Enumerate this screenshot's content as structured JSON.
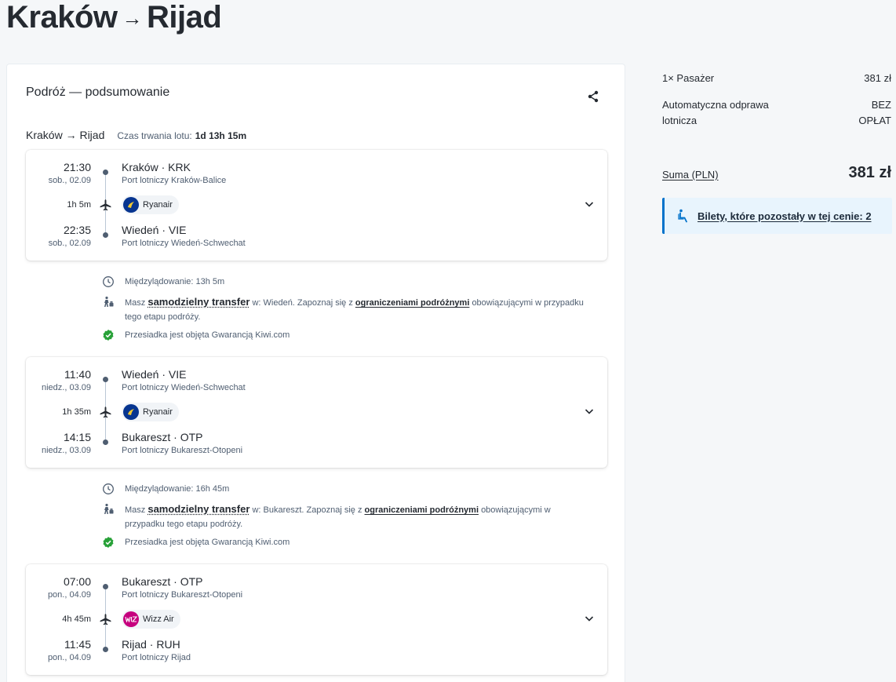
{
  "header": {
    "origin": "Kraków",
    "arrow": "→",
    "destination": "Rijad"
  },
  "summary": {
    "title": "Podróż — podsumowanie",
    "route_label": "Kraków → Rijad",
    "duration_label": "Czas trwania lotu:",
    "duration_value": "1d 13h 15m"
  },
  "segments": [
    {
      "dep_time": "21:30",
      "dep_date": "sob., 02.09",
      "dep_place": "Kraków · KRK",
      "dep_airport": "Port lotniczy Kraków-Balice",
      "duration": "1h 5m",
      "airline": "Ryanair",
      "arr_time": "22:35",
      "arr_date": "sob., 02.09",
      "arr_place": "Wiedeń · VIE",
      "arr_airport": "Port lotniczy Wiedeń-Schwechat"
    },
    {
      "dep_time": "11:40",
      "dep_date": "niedz., 03.09",
      "dep_place": "Wiedeń · VIE",
      "dep_airport": "Port lotniczy Wiedeń-Schwechat",
      "duration": "1h 35m",
      "airline": "Ryanair",
      "arr_time": "14:15",
      "arr_date": "niedz., 03.09",
      "arr_place": "Bukareszt · OTP",
      "arr_airport": "Port lotniczy Bukareszt-Otopeni"
    },
    {
      "dep_time": "07:00",
      "dep_date": "pon., 04.09",
      "dep_place": "Bukareszt · OTP",
      "dep_airport": "Port lotniczy Bukareszt-Otopeni",
      "duration": "4h 45m",
      "airline": "Wizz Air",
      "arr_time": "11:45",
      "arr_date": "pon., 04.09",
      "arr_place": "Rijad · RUH",
      "arr_airport": "Port lotniczy Rijad"
    }
  ],
  "layovers": [
    {
      "stopover": "Międzylądowanie: 13h 5m",
      "transfer_pre": "Masz",
      "transfer_link": "samodzielny transfer",
      "transfer_mid": "w: Wiedeń. Zapoznaj się z",
      "restrictions_link": "ograniczeniami podróżnymi",
      "transfer_post": "obowiązującymi w przypadku tego etapu podróży.",
      "guarantee": "Przesiadka jest objęta Gwarancją Kiwi.com"
    },
    {
      "stopover": "Międzylądowanie: 16h 45m",
      "transfer_pre": "Masz",
      "transfer_link": "samodzielny transfer",
      "transfer_mid": "w: Bukareszt. Zapoznaj się z",
      "restrictions_link": "ograniczeniami podróżnymi",
      "transfer_post": "obowiązującymi w przypadku tego etapu podróży.",
      "guarantee": "Przesiadka jest objęta Gwarancją Kiwi.com"
    }
  ],
  "sidebar": {
    "passenger_label": "1× Pasażer",
    "passenger_price": "381 zł",
    "checkin_label": "Automatyczna odprawa lotnicza",
    "checkin_value": "BEZ OPŁAT",
    "sum_label": "Suma (PLN)",
    "sum_value": "381 zł",
    "tickets_left": "Bilety, które pozostały w tej cenie: 2"
  },
  "colors": {
    "accent": "#0172cb",
    "ryanair": "#073590",
    "wizzair": "#c6007e",
    "guarantee": "#28a138"
  }
}
